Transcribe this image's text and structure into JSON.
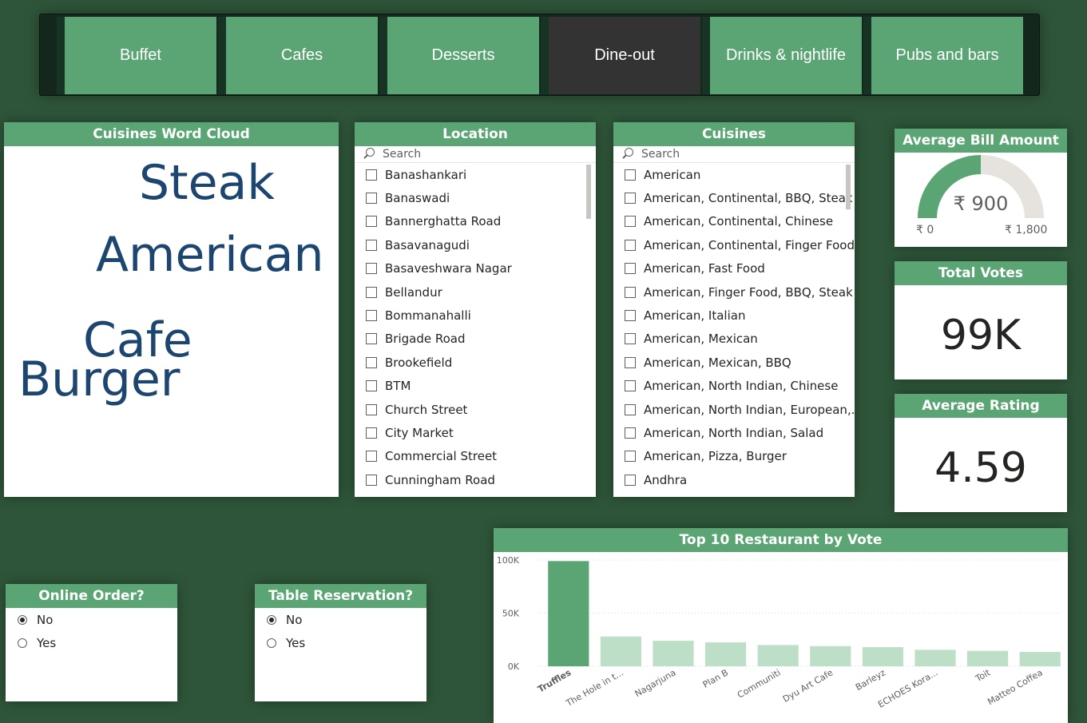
{
  "tabs": [
    "Buffet",
    "Cafes",
    "Desserts",
    "Dine-out",
    "Drinks & nightlife",
    "Pubs and bars"
  ],
  "active_tab": "Dine-out",
  "word_cloud": {
    "title": "Cuisines Word Cloud",
    "words": [
      "Steak",
      "American",
      "Cafe",
      "Burger"
    ]
  },
  "location": {
    "title": "Location",
    "search_placeholder": "Search",
    "items": [
      "Banashankari",
      "Banaswadi",
      "Bannerghatta Road",
      "Basavanagudi",
      "Basaveshwara Nagar",
      "Bellandur",
      "Bommanahalli",
      "Brigade Road",
      "Brookefield",
      "BTM",
      "Church Street",
      "City Market",
      "Commercial Street",
      "Cunningham Road"
    ]
  },
  "cuisines": {
    "title": "Cuisines",
    "search_placeholder": "Search",
    "items": [
      "American",
      "American, Continental, BBQ, Steak",
      "American, Continental, Chinese",
      "American, Continental, Finger Food",
      "American, Fast Food",
      "American, Finger Food, BBQ, Steak",
      "American, Italian",
      "American, Mexican",
      "American, Mexican, BBQ",
      "American, North Indian, Chinese",
      "American, North Indian, European,...",
      "American, North Indian, Salad",
      "American, Pizza, Burger",
      "Andhra"
    ]
  },
  "avg_bill": {
    "title": "Average Bill Amount",
    "value_label": "₹ 900",
    "min_label": "₹ 0",
    "max_label": "₹ 1,800",
    "value": 900,
    "min": 0,
    "max": 1800,
    "fill_color": "#5ba574",
    "track_color": "#e6e2dd"
  },
  "total_votes": {
    "title": "Total Votes",
    "value": "99K"
  },
  "avg_rating": {
    "title": "Average Rating",
    "value": "4.59"
  },
  "online_order": {
    "title": "Online Order?",
    "options": [
      "No",
      "Yes"
    ],
    "selected": "No"
  },
  "table_reservation": {
    "title": "Table Reservation?",
    "options": [
      "No",
      "Yes"
    ],
    "selected": "No"
  },
  "chart_data": {
    "type": "bar",
    "title": "Top 10 Restaurant by Vote",
    "categories": [
      "Truffles",
      "The Hole in t...",
      "Nagarjuna",
      "Plan B",
      "Communiti",
      "Dyu Art Cafe",
      "Barleyz",
      "ECHOES Kora...",
      "Toit",
      "Matteo Coffea"
    ],
    "values": [
      99000,
      28000,
      24000,
      22500,
      20000,
      19000,
      18000,
      15500,
      14500,
      13500
    ],
    "ylim": [
      0,
      100000
    ],
    "yticks": [
      "0K",
      "50K",
      "100K"
    ],
    "ytick_values": [
      0,
      50000,
      100000
    ],
    "highlight_index": 0,
    "highlight_color": "#5ba574",
    "bar_color": "#bddfc8",
    "grid": true
  }
}
